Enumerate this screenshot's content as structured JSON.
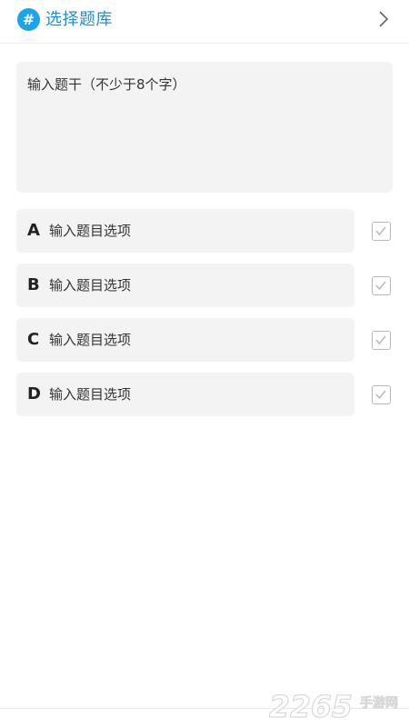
{
  "header": {
    "icon": "hash-icon",
    "title": "选择题库",
    "chevron_icon": "chevron-right-icon",
    "accent_color": "#1ba3ec"
  },
  "question": {
    "placeholder": "输入题干（不少于8个字）",
    "value": ""
  },
  "options": [
    {
      "letter": "A",
      "placeholder": "输入题目选项",
      "checked": true
    },
    {
      "letter": "B",
      "placeholder": "输入题目选项",
      "checked": true
    },
    {
      "letter": "C",
      "placeholder": "输入题目选项",
      "checked": true
    },
    {
      "letter": "D",
      "placeholder": "输入题目选项",
      "checked": true
    }
  ],
  "watermark": {
    "number": "2265",
    "text": "手游网"
  }
}
